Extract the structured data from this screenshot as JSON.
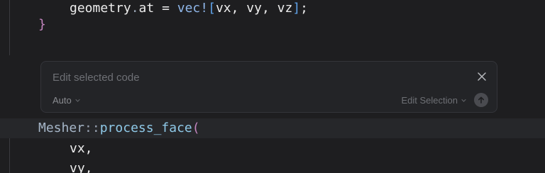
{
  "code": {
    "line1": {
      "object": "geometry",
      "dot": ".",
      "field": "at",
      "assign": " = ",
      "macro": "vec!",
      "open_bracket": "[",
      "args": "vx, vy, vz",
      "close_bracket": "]",
      "semicolon": ";"
    },
    "line2": {
      "brace": "}"
    },
    "line3": {
      "type": "Mesher",
      "path_sep": "::",
      "function": "process_face",
      "open_paren": "("
    },
    "line4": {
      "text": "vx,"
    },
    "line5": {
      "text": "vy,"
    }
  },
  "inline_edit": {
    "placeholder": "Edit selected code",
    "model_label": "Auto",
    "mode_label": "Edit Selection",
    "close_icon": "close-icon",
    "submit_icon": "arrow-up-icon"
  },
  "colors": {
    "background": "#1e1e20",
    "panel": "#232427",
    "keyword_magenta": "#c586c0",
    "bracket_blue": "#5fa2e8"
  }
}
